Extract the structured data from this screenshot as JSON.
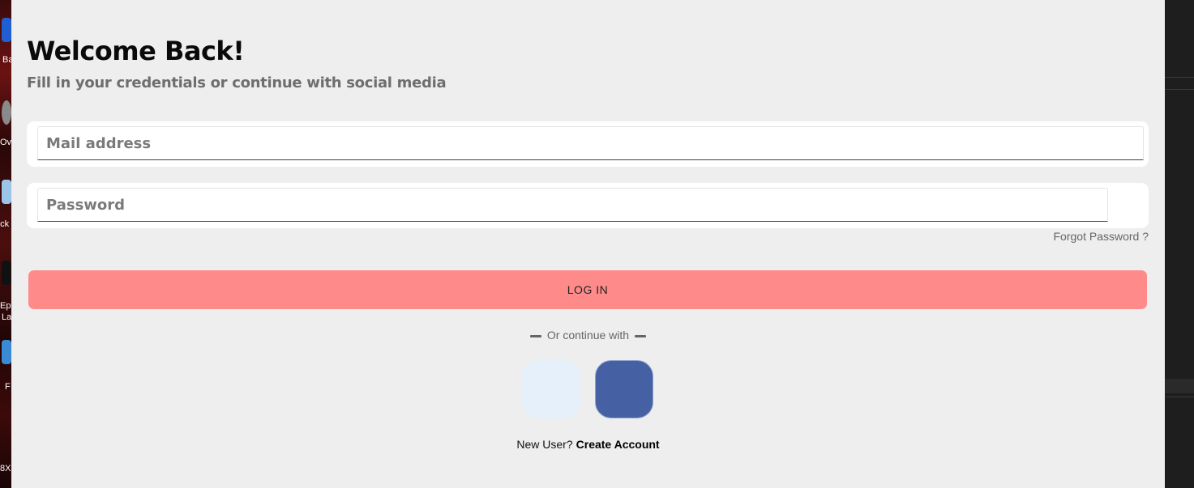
{
  "desktop": {
    "labels": [
      "Ba",
      "Ov",
      "ock",
      "Epi",
      "La",
      "F",
      "8X"
    ]
  },
  "login": {
    "title": "Welcome Back!",
    "subtitle": "Fill in your credentials or continue with social media",
    "email": {
      "placeholder": "Mail address",
      "value": ""
    },
    "password": {
      "placeholder": "Password",
      "value": ""
    },
    "forgot_label": "Forgot Password ?",
    "login_label": "LOG IN",
    "divider_label": "Or continue with",
    "social": [
      {
        "icon": "google-icon",
        "color": "#e6f0fa"
      },
      {
        "icon": "facebook-icon",
        "color": "#4560a3"
      }
    ],
    "signup_prompt": "New User?",
    "signup_link": "Create Account"
  },
  "colors": {
    "accent": "#ff8a8a",
    "background": "#eeeeee"
  }
}
